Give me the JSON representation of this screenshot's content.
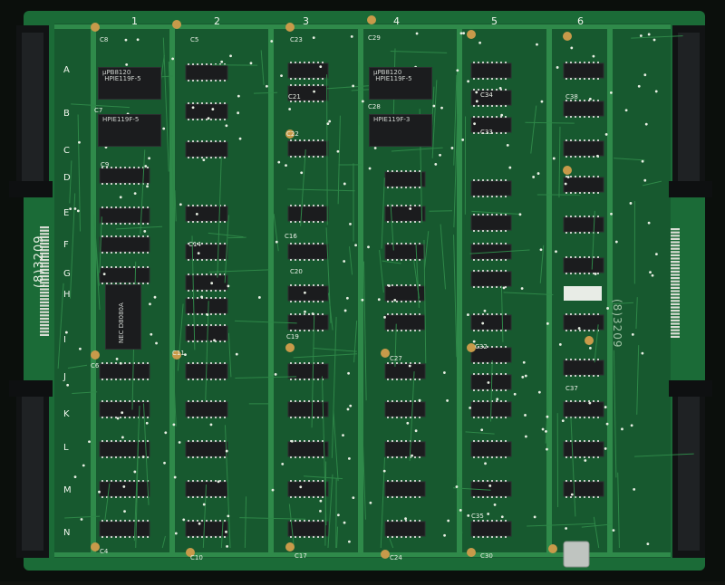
{
  "board": {
    "part_number": "(8)3209",
    "part_number_rotated": "(8)3209",
    "column_labels": [
      "1",
      "2",
      "3",
      "4",
      "5",
      "6"
    ],
    "row_labels": [
      "A",
      "B",
      "C",
      "D",
      "E",
      "F",
      "G",
      "H",
      "I",
      "J",
      "K",
      "L",
      "M",
      "N"
    ],
    "chip_labels": {
      "a1": "μPB8120\n HPIE119F-5",
      "b1": "HPIE119F-5",
      "a4": "μPB8120\n HPIE119F-5",
      "b4": "HPIE119F-3",
      "cpu": "NEC D8080A"
    },
    "component_refs": [
      "C8",
      "C9",
      "C16",
      "C19",
      "C20",
      "C21",
      "C22",
      "C23",
      "C27",
      "C28",
      "C29",
      "C32",
      "C33",
      "C34",
      "C35",
      "C37",
      "C38",
      "C4",
      "C5",
      "C6",
      "C7",
      "C10",
      "C11",
      "C14",
      "C17",
      "C24",
      "C30"
    ]
  },
  "colors": {
    "substrate": "#0f3d22",
    "mask": "#1e6a37",
    "trace": "#2f8a4a",
    "edge": "#0b0f0c",
    "chip": "#1b1c1e",
    "cap": "#c89a4a",
    "silk": "#eef3ea"
  }
}
